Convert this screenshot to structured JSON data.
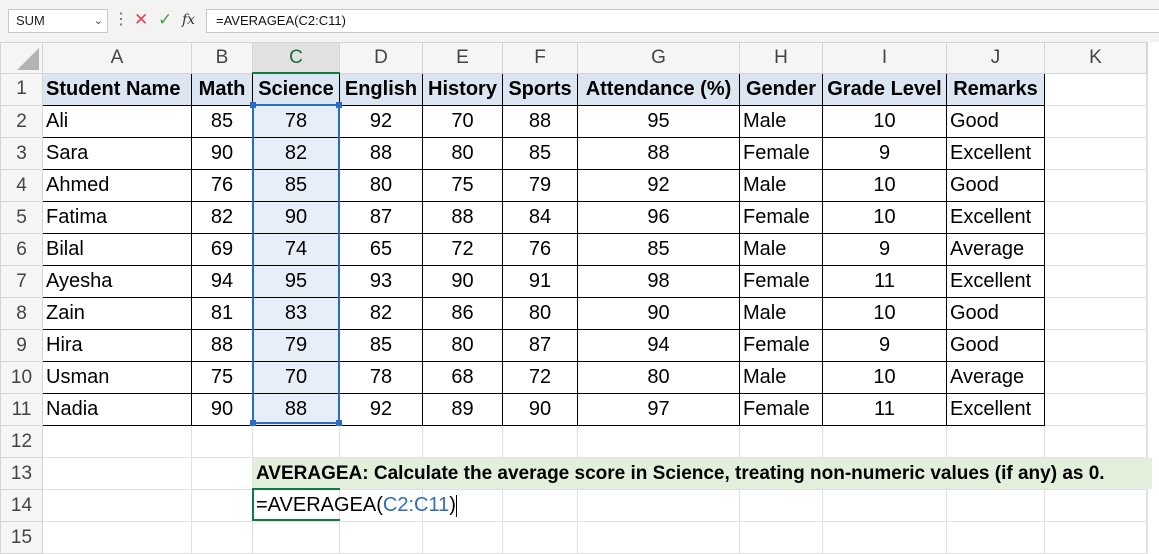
{
  "formula_bar": {
    "name_box": "SUM",
    "formula": "=AVERAGEA(C2:C11)",
    "cancel_icon": "close-icon",
    "enter_icon": "check-icon",
    "function_icon": "fx-icon"
  },
  "columns": [
    "A",
    "B",
    "C",
    "D",
    "E",
    "F",
    "G",
    "H",
    "I",
    "J",
    "K"
  ],
  "selected_column": "C",
  "rows": [
    "1",
    "2",
    "3",
    "4",
    "5",
    "6",
    "7",
    "8",
    "9",
    "10",
    "11",
    "12",
    "13",
    "14",
    "15"
  ],
  "headers": [
    "Student Name",
    "Math",
    "Science",
    "English",
    "History",
    "Sports",
    "Attendance (%)",
    "Gender",
    "Grade Level",
    "Remarks"
  ],
  "students": [
    {
      "name": "Ali",
      "math": "85",
      "science": "78",
      "english": "92",
      "history": "70",
      "sports": "88",
      "attendance": "95",
      "gender": "Male",
      "grade": "10",
      "remarks": "Good"
    },
    {
      "name": "Sara",
      "math": "90",
      "science": "82",
      "english": "88",
      "history": "80",
      "sports": "85",
      "attendance": "88",
      "gender": "Female",
      "grade": "9",
      "remarks": "Excellent"
    },
    {
      "name": "Ahmed",
      "math": "76",
      "science": "85",
      "english": "80",
      "history": "75",
      "sports": "79",
      "attendance": "92",
      "gender": "Male",
      "grade": "10",
      "remarks": "Good"
    },
    {
      "name": "Fatima",
      "math": "82",
      "science": "90",
      "english": "87",
      "history": "88",
      "sports": "84",
      "attendance": "96",
      "gender": "Female",
      "grade": "10",
      "remarks": "Excellent"
    },
    {
      "name": "Bilal",
      "math": "69",
      "science": "74",
      "english": "65",
      "history": "72",
      "sports": "76",
      "attendance": "85",
      "gender": "Male",
      "grade": "9",
      "remarks": "Average"
    },
    {
      "name": "Ayesha",
      "math": "94",
      "science": "95",
      "english": "93",
      "history": "90",
      "sports": "91",
      "attendance": "98",
      "gender": "Female",
      "grade": "11",
      "remarks": "Excellent"
    },
    {
      "name": "Zain",
      "math": "81",
      "science": "83",
      "english": "82",
      "history": "86",
      "sports": "80",
      "attendance": "90",
      "gender": "Male",
      "grade": "10",
      "remarks": "Good"
    },
    {
      "name": "Hira",
      "math": "88",
      "science": "79",
      "english": "85",
      "history": "80",
      "sports": "87",
      "attendance": "94",
      "gender": "Female",
      "grade": "9",
      "remarks": "Good"
    },
    {
      "name": "Usman",
      "math": "75",
      "science": "70",
      "english": "78",
      "history": "68",
      "sports": "72",
      "attendance": "80",
      "gender": "Male",
      "grade": "10",
      "remarks": "Average"
    },
    {
      "name": "Nadia",
      "math": "90",
      "science": "88",
      "english": "92",
      "history": "89",
      "sports": "90",
      "attendance": "97",
      "gender": "Female",
      "grade": "11",
      "remarks": "Excellent"
    }
  ],
  "note": "AVERAGEA: Calculate the average score in Science, treating non-numeric values (if any) as 0.",
  "editing": {
    "prefix": "=AVERAGEA(",
    "ref": "C2:C11",
    "suffix": ")"
  },
  "colors": {
    "header_fill": "#dce6f2",
    "note_fill": "#e2efda",
    "selection": "#2b6ec0",
    "active_cell": "#107c41"
  }
}
